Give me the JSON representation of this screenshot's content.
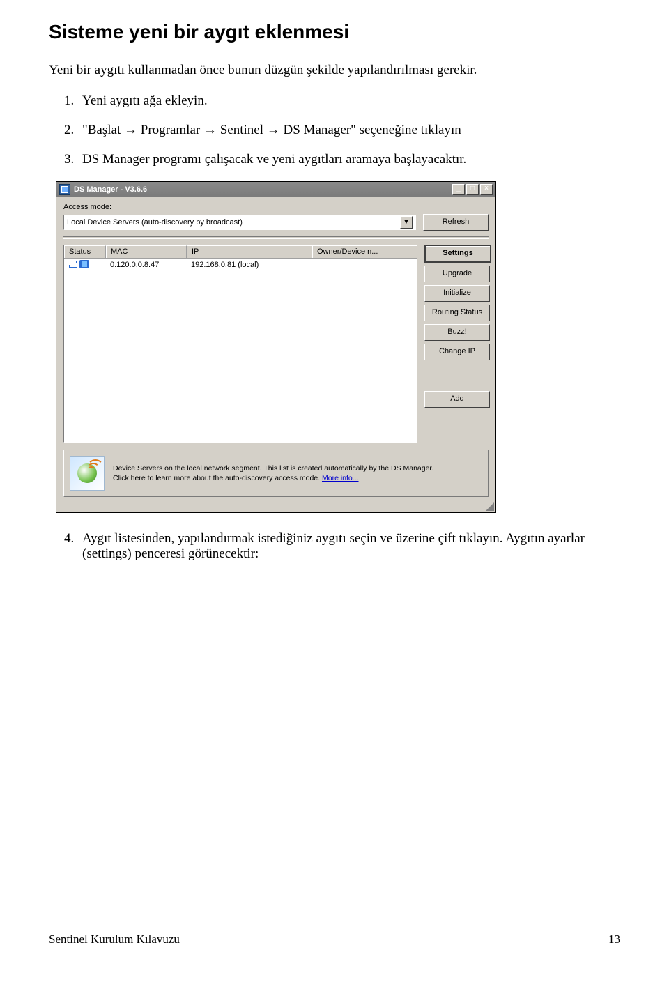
{
  "heading": "Sisteme yeni bir aygıt eklenmesi",
  "intro": "Yeni bir aygıtı kullanmadan önce bunun düzgün şekilde yapılandırılması gerekir.",
  "steps": {
    "s1": "Yeni aygıtı ağa ekleyin.",
    "s2_prefix": "\"Başlat ",
    "s2_p2": " Programlar ",
    "s2_p3": " Sentinel ",
    "s2_p4": " DS Manager\" seçeneğine tıklayın",
    "s3": "DS Manager programı çalışacak ve yeni aygıtları aramaya başlayacaktır.",
    "s4": "Aygıt listesinden, yapılandırmak istediğiniz aygıtı seçin ve üzerine çift tıklayın. Aygıtın ayarlar (settings) penceresi görünecektir:"
  },
  "arrows": "→",
  "window": {
    "title": "DS Manager - V3.6.6",
    "access_mode_label": "Access mode:",
    "access_mode_value": "Local Device Servers (auto-discovery by broadcast)",
    "buttons": {
      "refresh": "Refresh",
      "settings": "Settings",
      "upgrade": "Upgrade",
      "initialize": "Initialize",
      "routing": "Routing Status",
      "buzz": "Buzz!",
      "changeip": "Change IP",
      "add": "Add"
    },
    "columns": {
      "status": "Status",
      "mac": "MAC",
      "ip": "IP",
      "owner": "Owner/Device n..."
    },
    "row": {
      "mac": "0.120.0.0.8.47",
      "ip": "192.168.0.81 (local)",
      "owner": ""
    },
    "info": {
      "line1": "Device Servers on the local network segment. This list is created automatically by the DS Manager.",
      "line2_pre": "Click here to learn more about the auto-discovery access mode. ",
      "link": "More info..."
    }
  },
  "footer": {
    "left": "Sentinel Kurulum Kılavuzu",
    "right": "13"
  }
}
